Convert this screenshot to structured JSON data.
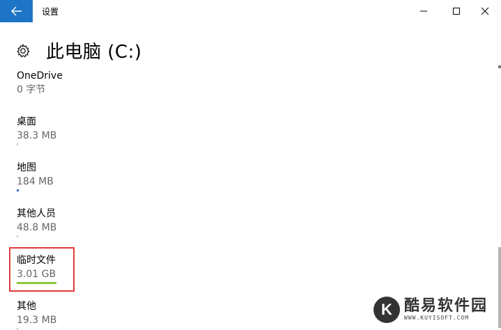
{
  "window": {
    "title": "设置",
    "accent": "#1e74c6"
  },
  "page": {
    "title": "此电脑 (C:)"
  },
  "items": [
    {
      "name": "OneDrive",
      "size": "0 字节",
      "bar_color": "#c8c8c8",
      "fill": 0.0
    },
    {
      "name": "桌面",
      "size": "38.3 MB",
      "bar_color": "#c8c8c8",
      "fill": 0.02
    },
    {
      "name": "地图",
      "size": "184 MB",
      "bar_color": "#2f6fd0",
      "fill": 0.06
    },
    {
      "name": "其他人员",
      "size": "48.8 MB",
      "bar_color": "#c8c8c8",
      "fill": 0.02
    },
    {
      "name": "临时文件",
      "size": "3.01 GB",
      "bar_color": "#8cc63f",
      "fill": 1.0
    },
    {
      "name": "其他",
      "size": "19.3 MB",
      "bar_color": "#c8c8c8",
      "fill": 0.01
    }
  ],
  "highlight_color": "#e03a3a",
  "watermark": {
    "logo": "K",
    "text": "酷易软件园",
    "url": "WWW.KUYISOFT.COM"
  }
}
